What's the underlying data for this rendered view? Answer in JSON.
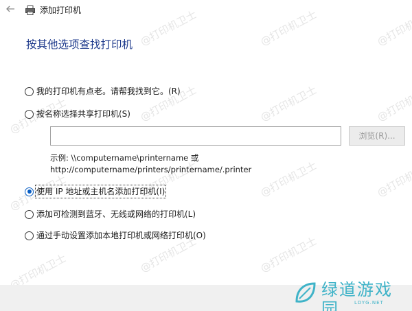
{
  "window": {
    "title": "添加打印机",
    "back_icon": "back-arrow-icon",
    "title_icon": "printer-icon"
  },
  "heading": "按其他选项查找打印机",
  "options": [
    {
      "label": "我的打印机有点老。请帮我找到它。(R)",
      "checked": false
    },
    {
      "label": "按名称选择共享打印机(S)",
      "checked": false
    },
    {
      "label": "使用 IP 地址或主机名添加打印机(I)",
      "checked": true
    },
    {
      "label": "添加可检测到蓝牙、无线或网络的打印机(L)",
      "checked": false
    },
    {
      "label": "通过手动设置添加本地打印机或网络打印机(O)",
      "checked": false
    }
  ],
  "share": {
    "input_value": "",
    "browse_label": "浏览(R)...",
    "example_line1": "示例: \\\\computername\\printername 或",
    "example_line2": "http://computername/printers/printername/.printer"
  },
  "watermark_text": "@打印机卫士",
  "logo": {
    "text": "绿道游戏园",
    "sub": "LDYG.NET"
  },
  "colors": {
    "heading": "#1e3a8c",
    "radio_checked": "#0a5fc4",
    "logo": "#3fb3c8"
  }
}
